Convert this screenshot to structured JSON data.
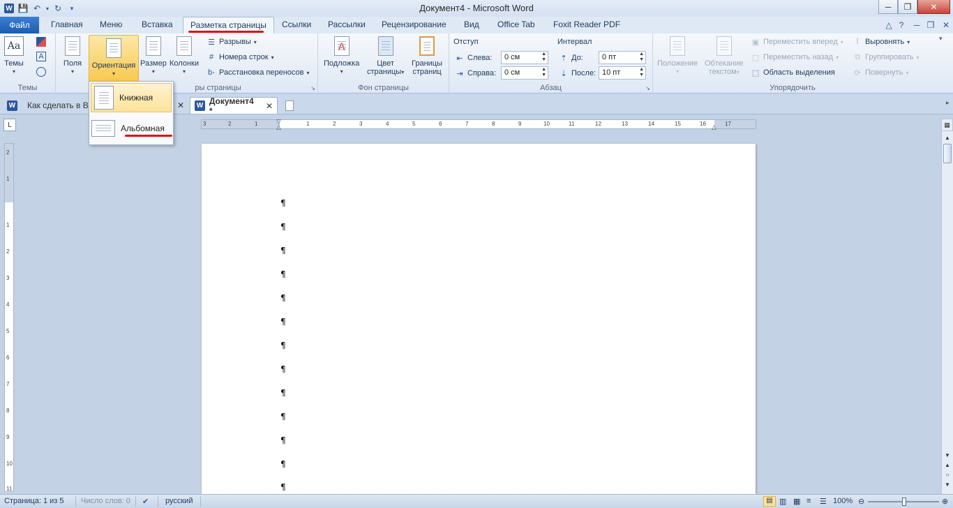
{
  "window": {
    "title": "Документ4 - Microsoft Word"
  },
  "ribbon_tabs": {
    "file": "Файл",
    "home": "Главная",
    "menu": "Меню",
    "insert": "Вставка",
    "page_layout": "Разметка страницы",
    "references": "Ссылки",
    "mailings": "Рассылки",
    "review": "Рецензирование",
    "view": "Вид",
    "office_tab": "Office Tab",
    "foxit": "Foxit Reader PDF",
    "active": "Разметка страницы"
  },
  "ribbon": {
    "themes": {
      "button": "Темы",
      "group": "Темы"
    },
    "page_setup": {
      "margins": "Поля",
      "orientation": "Ориентация",
      "size": "Размер",
      "columns": "Колонки",
      "breaks": "Разрывы",
      "line_numbers": "Номера строк",
      "hyphenation": "Расстановка переносов",
      "group_partial": "ры страницы"
    },
    "background": {
      "watermark": "Подложка",
      "page_color_1": "Цвет",
      "page_color_2": "страницы",
      "page_borders_1": "Границы",
      "page_borders_2": "страниц",
      "group": "Фон страницы"
    },
    "paragraph": {
      "indent_label": "Отступ",
      "left_label": "Слева:",
      "left_value": "0 см",
      "right_label": "Справа:",
      "right_value": "0 см",
      "spacing_label": "Интервал",
      "before_label": "До:",
      "before_value": "0 пт",
      "after_label": "После:",
      "after_value": "10 пт",
      "group": "Абзац"
    },
    "arrange": {
      "position_1": "Положение",
      "wrap_1": "Обтекание",
      "wrap_2": "текстом",
      "bring_forward": "Переместить вперед",
      "send_backward": "Переместить назад",
      "selection_pane": "Область выделения",
      "align": "Выровнять",
      "group_btn": "Группировать",
      "rotate": "Повернуть",
      "group": "Упорядочить"
    }
  },
  "orientation_menu": {
    "portrait": "Книжная",
    "landscape": "Альбомная"
  },
  "doc_tabs": [
    {
      "title": "Как сделать в Вор"
    },
    {
      "title": "Документ4 *"
    }
  ],
  "ruler": {
    "h_numbers": [
      "3",
      "2",
      "1",
      "1",
      "2",
      "3",
      "4",
      "5",
      "6",
      "7",
      "8",
      "9",
      "10",
      "11",
      "12",
      "13",
      "14",
      "15",
      "16",
      "17"
    ],
    "v_numbers": [
      "2",
      "1",
      "1",
      "2",
      "3",
      "4",
      "5",
      "6",
      "7",
      "8",
      "9",
      "10",
      "11"
    ]
  },
  "document": {
    "pilcrow": "¶",
    "paragraph_count": 13
  },
  "statusbar": {
    "page": "Страница: 1 из 5",
    "words": "Число слов: 0",
    "language": "русский",
    "zoom": "100%"
  },
  "colors": {
    "accent": "#2b579a",
    "highlight": "#f9c84f",
    "annotation": "#e01010"
  }
}
